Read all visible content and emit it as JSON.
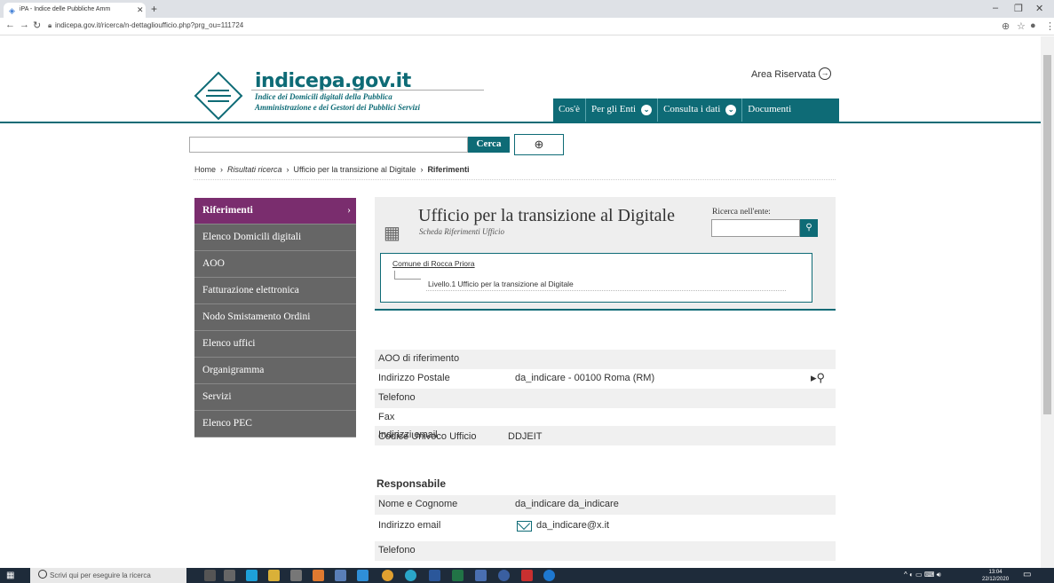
{
  "browser": {
    "tab_title": "iPA - Indice delle Pubbliche Amm",
    "url": "indicepa.gov.it/ricerca/n-dettaglioufficio.php?prg_ou=111724"
  },
  "header": {
    "site_name": "indicepa.gov.it",
    "subtitle_1": "Indice dei Domicili digitali della Pubblica",
    "subtitle_2": "Amministrazione e dei Gestori dei Pubblici Servizi",
    "area_riservata": "Area Riservata",
    "nav": [
      {
        "label": "Cos'è",
        "has_dropdown": false
      },
      {
        "label": "Per gli Enti",
        "has_dropdown": true
      },
      {
        "label": "Consulta i dati",
        "has_dropdown": true
      },
      {
        "label": "Documenti",
        "has_dropdown": false
      }
    ],
    "brand_color": "#0e6b76"
  },
  "search": {
    "button_label": "Cerca",
    "value": ""
  },
  "breadcrumb": {
    "home": "Home",
    "results": "Risultati ricerca",
    "office": "Ufficio per la transizione al Digitale",
    "current": "Riferimenti"
  },
  "sidebar": {
    "items": [
      {
        "label": "Riferimenti",
        "active": true
      },
      {
        "label": "Elenco Domicili digitali",
        "active": false
      },
      {
        "label": "AOO",
        "active": false
      },
      {
        "label": "Fatturazione elettronica",
        "active": false
      },
      {
        "label": "Nodo Smistamento Ordini",
        "active": false
      },
      {
        "label": "Elenco uffici",
        "active": false
      },
      {
        "label": "Organigramma",
        "active": false
      },
      {
        "label": "Servizi",
        "active": false
      },
      {
        "label": "Elenco PEC",
        "active": false
      }
    ],
    "active_color": "#7a2d6e"
  },
  "office": {
    "title": "Ufficio per la transizione al Digitale",
    "subtitle": "Scheda Riferimenti Ufficio",
    "ricerca_label": "Ricerca nell'ente:",
    "hierarchy_parent": "Comune di Rocca Priora",
    "hierarchy_child": "Livello.1 Ufficio per la transizione al Digitale"
  },
  "details": {
    "rows": [
      {
        "label": "AOO di riferimento",
        "value": ""
      },
      {
        "label": "Indirizzo Postale",
        "value": "da_indicare - 00100 Roma (RM)"
      },
      {
        "label": "Telefono",
        "value": ""
      },
      {
        "label": "Fax",
        "value": ""
      },
      {
        "label": "Indirizzi email",
        "value": ""
      },
      {
        "label": "Codice Univoco Ufficio",
        "value": "DDJEIT"
      }
    ]
  },
  "responsabile": {
    "title": "Responsabile",
    "rows": [
      {
        "label": "Nome e Cognome",
        "value": "da_indicare da_indicare"
      },
      {
        "label": "Indirizzo email",
        "value": "da_indicare@x.it"
      },
      {
        "label": "Telefono",
        "value": ""
      }
    ]
  },
  "taskbar": {
    "search_placeholder": "Scrivi qui per eseguire la ricerca",
    "time": "13:04",
    "date": "22/12/2020"
  }
}
